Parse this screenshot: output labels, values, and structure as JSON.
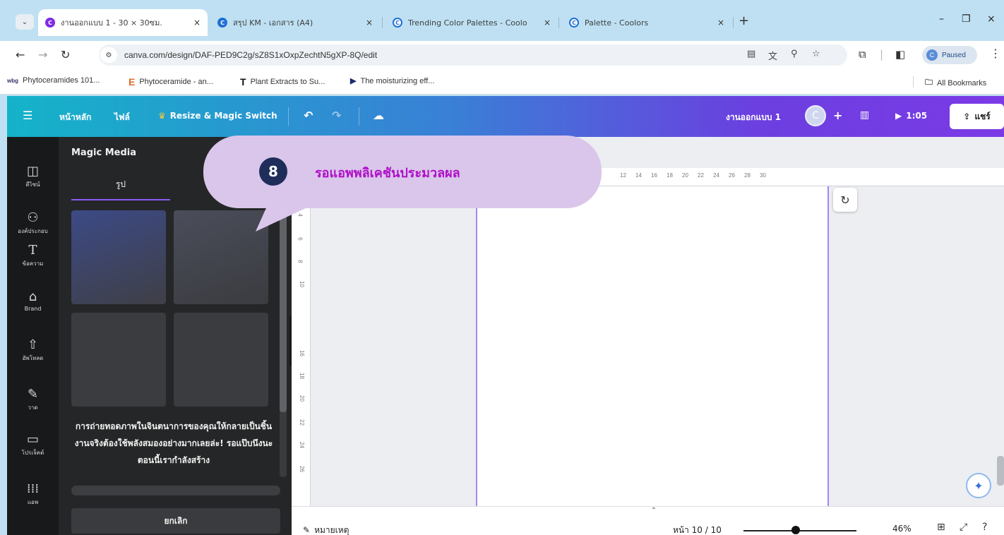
{
  "browser": {
    "tabs": [
      {
        "title": "งานออกแบบ 1 - 30 × 30ซม.",
        "close": "×"
      },
      {
        "title": "สรุป KM - เอกสาร (A4)",
        "close": "×"
      },
      {
        "title": "Trending Color Palettes - Coolo",
        "close": "×"
      },
      {
        "title": "Palette - Coolors",
        "close": "×"
      }
    ],
    "new_tab": "+",
    "window_controls": {
      "minimize": "–",
      "restore": "❐",
      "close": "×"
    },
    "url": "canva.com/design/DAF-PED9C2g/sZ8S1xOxpZechtN5gXP-8Q/edit",
    "profile_status": "Paused",
    "profile_initial": "C",
    "bookmarks": [
      {
        "label": "Phytoceramides 101...",
        "icon": "wbg"
      },
      {
        "label": "Phytoceramide - an...",
        "icon": "E"
      },
      {
        "label": "Plant Extracts to Su...",
        "icon": "T"
      },
      {
        "label": "The moisturizing eff...",
        "icon": "▶"
      }
    ],
    "all_bookmarks": "All Bookmarks"
  },
  "header": {
    "home": "หน้าหลัก",
    "file": "ไฟล์",
    "resize": "Resize & Magic Switch",
    "design_name": "งานออกแบบ 1",
    "avatar_initial": "C",
    "add": "+",
    "present_time": "1:05",
    "share": "แชร์"
  },
  "rail": [
    {
      "label": "ดีไซน์",
      "icon": "layout-icon"
    },
    {
      "label": "องค์ประกอบ",
      "icon": "elements-icon"
    },
    {
      "label": "ข้อความ",
      "icon": "text-icon"
    },
    {
      "label": "Brand",
      "icon": "brand-icon"
    },
    {
      "label": "อัพโหลด",
      "icon": "upload-icon"
    },
    {
      "label": "วาด",
      "icon": "draw-icon"
    },
    {
      "label": "โปรเจ็คต์",
      "icon": "folder-icon"
    },
    {
      "label": "แอพ",
      "icon": "apps-icon"
    }
  ],
  "panel": {
    "title": "Magic Media",
    "tab_label": "รูป",
    "message": "การถ่ายทอดภาพในจินตนาการของคุณให้กลายเป็นชิ้นงานจริงต้องใช้พลังสมองอย่างมากเลยล่ะ! รอแป๊บนึงนะ ตอนนี้เรากำลังสร้าง",
    "progress": 0,
    "cancel": "ยกเลิก"
  },
  "ruler": {
    "top": [
      "12",
      "14",
      "16",
      "18",
      "20",
      "22",
      "24",
      "26",
      "28",
      "30"
    ],
    "left": [
      "4",
      "6",
      "8",
      "10",
      "16",
      "18",
      "20",
      "22",
      "24",
      "26"
    ]
  },
  "footer": {
    "notes": "หมายเหตุ",
    "page": "หน้า 10 / 10",
    "zoom": "46%",
    "zoom_level": 0.46
  },
  "callout": {
    "step": "8",
    "text": "รอแอพพลิเคชันประมวลผล"
  },
  "colors": {
    "accent_purple": "#8b5cf6",
    "callout_bg": "#d9c6ea",
    "callout_text": "#b010c8",
    "badge": "#1f2d5a"
  }
}
